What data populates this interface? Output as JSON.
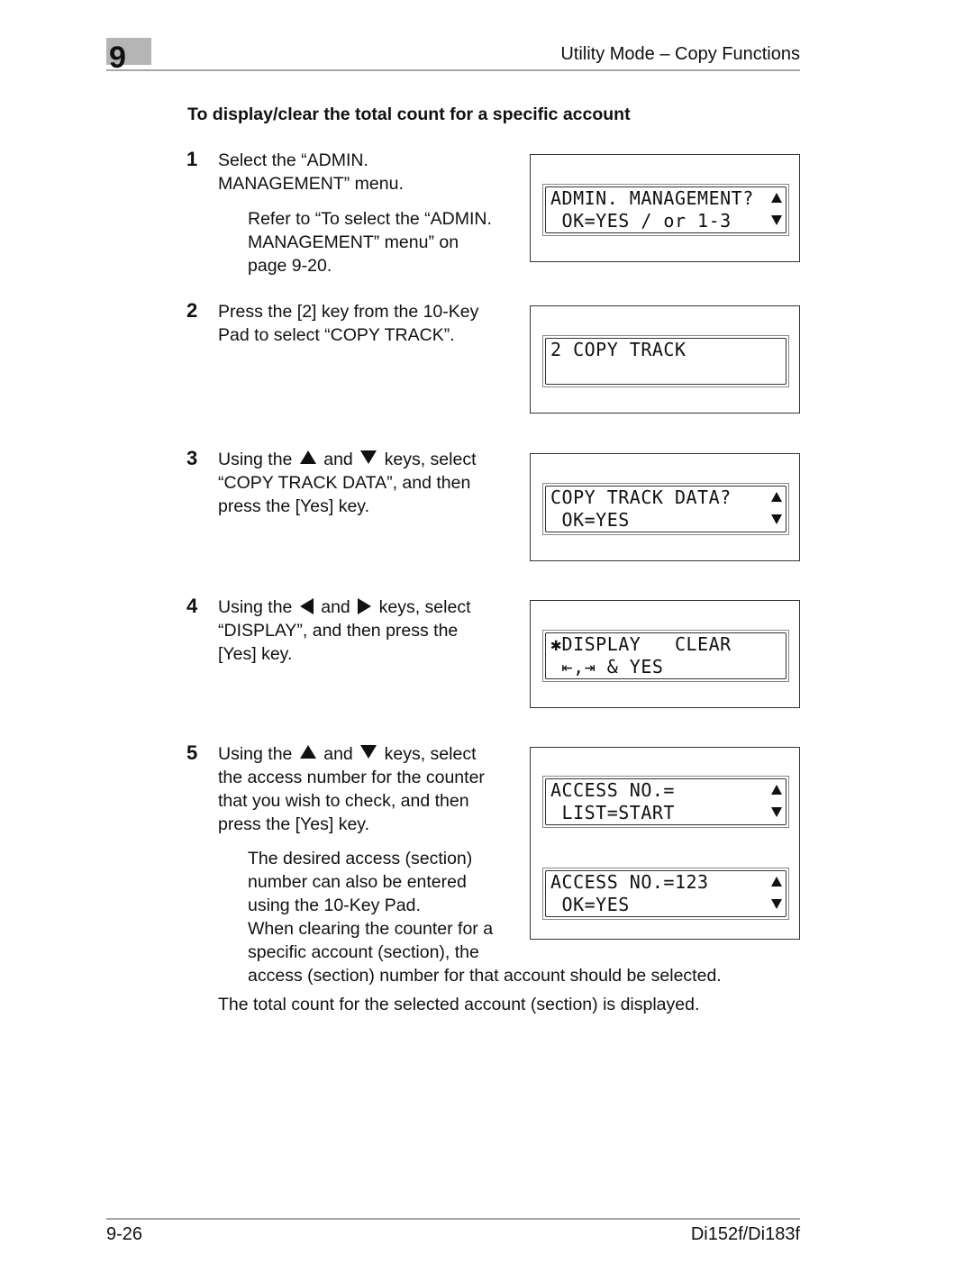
{
  "header": {
    "chapter_number": "9",
    "title": "Utility Mode – Copy Functions"
  },
  "section_title": "To display/clear the total count for a specific account",
  "steps": [
    {
      "number": "1",
      "text_lines": [
        "Select the “ADMIN.",
        "MANAGEMENT” menu."
      ],
      "note_lines": [
        "Refer to “To select the “ADMIN.",
        "MANAGEMENT” menu” on",
        "page 9-20."
      ],
      "lcd": [
        {
          "line1": "ADMIN. MANAGEMENT?",
          "line2": " OK=YES / or 1-3",
          "arrows": true
        }
      ]
    },
    {
      "number": "2",
      "text_lines": [
        "Press the [2] key from the 10-Key",
        "Pad to select “COPY TRACK”."
      ],
      "lcd": [
        {
          "line1": "2 COPY TRACK",
          "line2": "",
          "arrows": false
        }
      ]
    },
    {
      "number": "3",
      "text_a": "Using the",
      "key_a": "up-arrow",
      "text_b": "and",
      "key_b": "down-arrow",
      "text_c": "keys, select",
      "text_lines": [
        "“COPY TRACK DATA”, and then",
        "press the [Yes] key."
      ],
      "lcd": [
        {
          "line1": "COPY TRACK DATA?",
          "line2": " OK=YES",
          "arrows": true
        }
      ]
    },
    {
      "number": "4",
      "text_a": "Using the",
      "key_a": "left-arrow",
      "text_b": "and",
      "key_b": "right-arrow",
      "text_c": "keys, select",
      "text_lines": [
        "“DISPLAY”, and then press the",
        "[Yes] key."
      ],
      "lcd": [
        {
          "line1": "✱DISPLAY   CLEAR",
          "line2": " ⇤,⇥ & YES",
          "arrows": false
        }
      ]
    },
    {
      "number": "5",
      "text_a": "Using the",
      "key_a": "up-arrow",
      "text_b": "and",
      "key_b": "down-arrow",
      "text_c": "keys, select",
      "text_lines": [
        "the access number for the counter",
        "that you wish to check, and then",
        "press the [Yes] key."
      ],
      "note_lines": [
        "The desired access (section)",
        "number can also be entered",
        "using the 10-Key Pad.",
        "When clearing the counter for a",
        "specific account (section), the",
        "access (section) number for that account should be selected."
      ],
      "lcd": [
        {
          "line1": "ACCESS NO.=",
          "line2": " LIST=START",
          "arrows": true
        },
        {
          "line1": "ACCESS NO.=123",
          "line2": " OK=YES",
          "arrows": true
        }
      ]
    }
  ],
  "result_text": "The total count for the selected account (section) is displayed.",
  "footer": {
    "page_number": "9-26",
    "model": "Di152f/Di183f"
  }
}
